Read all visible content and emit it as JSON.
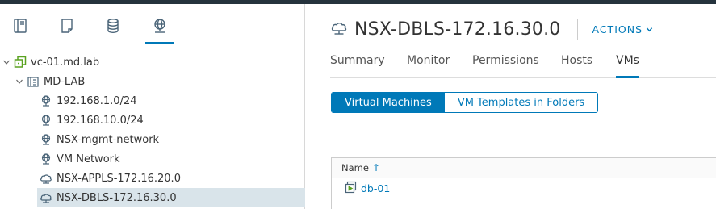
{
  "navigator": {
    "tabs": [
      {
        "name": "hosts-and-clusters",
        "icon": "hosts-clusters-icon",
        "active": false
      },
      {
        "name": "vms-and-templates",
        "icon": "vms-templates-icon",
        "active": false
      },
      {
        "name": "storage",
        "icon": "database-icon",
        "active": false
      },
      {
        "name": "networking",
        "icon": "network-globe-icon",
        "active": true
      }
    ],
    "tree": [
      {
        "label": "vc-01.md.lab",
        "level": 0,
        "expanded": true,
        "icon": "vcenter-icon"
      },
      {
        "label": "MD-LAB",
        "level": 1,
        "expanded": true,
        "icon": "datacenter-icon"
      },
      {
        "label": "192.168.1.0/24",
        "level": 2,
        "icon": "network-icon"
      },
      {
        "label": "192.168.10.0/24",
        "level": 2,
        "icon": "network-icon"
      },
      {
        "label": "NSX-mgmt-network",
        "level": 2,
        "icon": "network-icon"
      },
      {
        "label": "VM Network",
        "level": 2,
        "icon": "network-icon"
      },
      {
        "label": "NSX-APPLS-172.16.20.0",
        "level": 2,
        "icon": "opaque-network-icon"
      },
      {
        "label": "NSX-DBLS-172.16.30.0",
        "level": 2,
        "icon": "opaque-network-icon",
        "selected": true
      }
    ]
  },
  "header": {
    "title": "NSX-DBLS-172.16.30.0",
    "actions_label": "ACTIONS"
  },
  "tabs": [
    {
      "label": "Summary",
      "active": false
    },
    {
      "label": "Monitor",
      "active": false
    },
    {
      "label": "Permissions",
      "active": false
    },
    {
      "label": "Hosts",
      "active": false
    },
    {
      "label": "VMs",
      "active": true
    }
  ],
  "view_toggle": {
    "options": [
      "Virtual Machines",
      "VM Templates in Folders"
    ],
    "selected": "Virtual Machines"
  },
  "table": {
    "columns": [
      "Name"
    ],
    "sort": "ascending",
    "rows": [
      {
        "name": "db-01",
        "icon": "vm-powered-on-icon"
      }
    ]
  },
  "colors": {
    "accent": "#0079b8",
    "selected_row": "#d9e4ea",
    "vcenter_green": "#5aa220"
  }
}
